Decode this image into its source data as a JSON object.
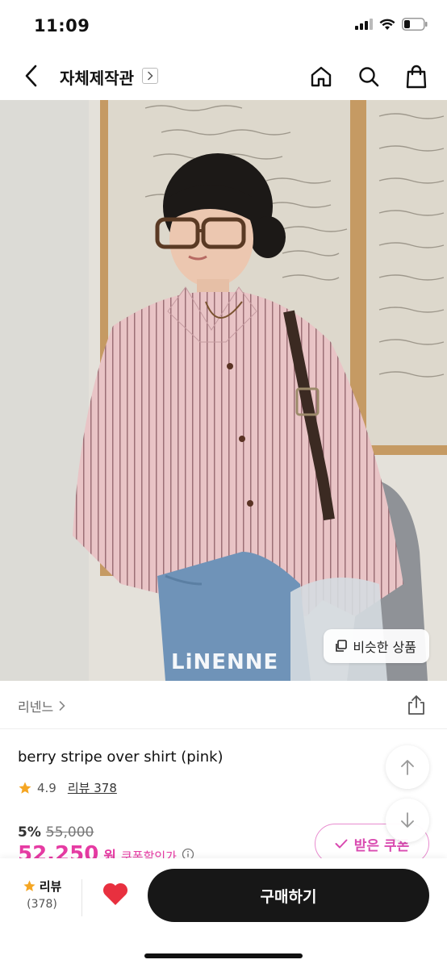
{
  "status_bar": {
    "time": "11:09",
    "icons": [
      "cellular-signal-icon",
      "wifi-icon",
      "battery-icon"
    ]
  },
  "nav": {
    "shop_title": "자체제작관",
    "icons": [
      "back-arrow-icon",
      "chevron-right-icon",
      "home-icon",
      "search-icon",
      "shopping-bag-icon"
    ]
  },
  "hero": {
    "brand_watermark": "LiNENNE",
    "similar_button_label": "비슷한 상품",
    "similar_icon": "copy-icon"
  },
  "brand": {
    "name": "리넨느",
    "icons": [
      "chevron-right-icon",
      "share-icon"
    ]
  },
  "product": {
    "name": "berry stripe over shirt (pink)",
    "rating": "4.9",
    "review_label": "리뷰 378",
    "discount": "5%",
    "original_price": "55,000",
    "sale_price": "52,250",
    "sale_currency": "원",
    "coupon_price_label": "쿠폰할인가",
    "coupon_button_label": "받은 쿠폰",
    "icons": [
      "star-icon",
      "info-icon",
      "check-icon",
      "arrow-up-icon",
      "arrow-down-icon"
    ]
  },
  "bottom_bar": {
    "review_label": "리뷰",
    "review_count": "(378)",
    "buy_label": "구매하기",
    "icons": [
      "star-icon",
      "heart-icon"
    ]
  },
  "colors": {
    "accent_pink": "#e63ba3",
    "coupon_border": "#e88ccf",
    "buy_button": "#171717",
    "star": "#f5a623",
    "heart": "#e8303f"
  }
}
